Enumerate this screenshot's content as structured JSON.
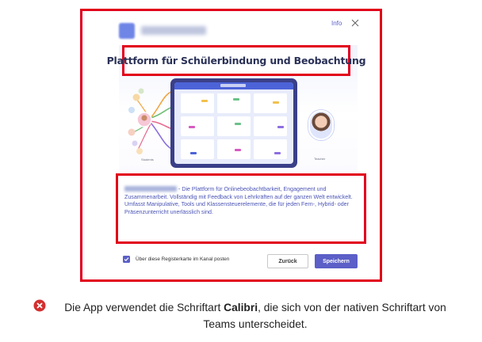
{
  "dialog": {
    "info_label": "Info",
    "hero_title": "Plattform für Schülerbindung und Beobachtung",
    "students_label": "Students",
    "teacher_label": "Teacher",
    "description": "- Die Plattform für Onlinebeobachtbarkeit, Engagement und Zusammenarbeit. Vollständig mit Feedback von Lehrkräften auf der ganzen Welt entwickelt. Umfasst Manipulative, Tools und Klassensteuerelemente, die für jeden Fern-, Hybrid- oder Präsenzunterricht unerlässlich sind.",
    "checkbox_label": "Über diese Registerkarte im Kanal posten",
    "checkbox_checked": true,
    "back_label": "Zurück",
    "save_label": "Speichern"
  },
  "caption": {
    "prefix": "Die App verwendet die Schriftart ",
    "font_name": "Calibri",
    "suffix": ", die sich von der nativen Schriftart von Teams unterscheidet."
  },
  "colors": {
    "highlight": "#e2001a",
    "accent": "#5b5fc7",
    "title": "#2a3157",
    "description": "#4b55b5"
  },
  "icons": {
    "close": "close-icon",
    "error": "error-icon",
    "checkbox": "check-icon"
  }
}
